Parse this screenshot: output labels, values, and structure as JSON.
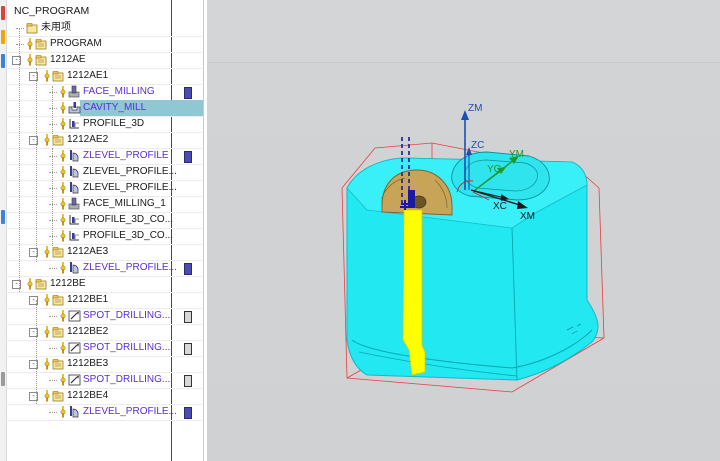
{
  "tree": {
    "root": "NC_PROGRAM",
    "rows": [
      {
        "label": "未用项",
        "kind": "group",
        "level": 1
      },
      {
        "label": "PROGRAM",
        "kind": "program",
        "level": 1
      },
      {
        "label": "1212AE",
        "kind": "program",
        "level": 1,
        "expand": "-"
      },
      {
        "label": "1212AE1",
        "kind": "program",
        "level": 2,
        "expand": "-"
      },
      {
        "label": "FACE_MILLING",
        "kind": "op",
        "icon": "face-milling-icon",
        "level": 3,
        "status": "regen"
      },
      {
        "label": "CAVITY_MILL",
        "kind": "op",
        "icon": "cavity-mill-icon",
        "level": 3,
        "selected": true
      },
      {
        "label": "PROFILE_3D",
        "kind": "op-dark",
        "icon": "profile-3d-icon",
        "level": 3
      },
      {
        "label": "1212AE2",
        "kind": "program",
        "level": 2,
        "expand": "-"
      },
      {
        "label": "ZLEVEL_PROFILE",
        "kind": "op",
        "icon": "zlevel-profile-icon",
        "level": 3,
        "status": "regen"
      },
      {
        "label": "ZLEVEL_PROFILE...",
        "kind": "op-dark",
        "icon": "zlevel-profile-icon",
        "level": 3
      },
      {
        "label": "ZLEVEL_PROFILE...",
        "kind": "op-dark",
        "icon": "zlevel-profile-icon",
        "level": 3
      },
      {
        "label": "FACE_MILLING_1",
        "kind": "op-dark",
        "icon": "face-milling-icon",
        "level": 3
      },
      {
        "label": "PROFILE_3D_CO...",
        "kind": "op-dark",
        "icon": "profile-3d-icon",
        "level": 3
      },
      {
        "label": "PROFILE_3D_CO...",
        "kind": "op-dark",
        "icon": "profile-3d-icon",
        "level": 3
      },
      {
        "label": "1212AE3",
        "kind": "program",
        "level": 2,
        "expand": "-"
      },
      {
        "label": "ZLEVEL_PROFILE...",
        "kind": "op",
        "icon": "zlevel-profile-icon",
        "level": 3,
        "status": "regen"
      },
      {
        "label": "1212BE",
        "kind": "program",
        "level": 1,
        "expand": "-"
      },
      {
        "label": "1212BE1",
        "kind": "program",
        "level": 2,
        "expand": "-"
      },
      {
        "label": "SPOT_DRILLING...",
        "kind": "op",
        "icon": "spot-drilling-icon",
        "level": 3,
        "status": "check"
      },
      {
        "label": "1212BE2",
        "kind": "program",
        "level": 2,
        "expand": "-"
      },
      {
        "label": "SPOT_DRILLING...",
        "kind": "op",
        "icon": "spot-drilling-icon",
        "level": 3,
        "status": "check"
      },
      {
        "label": "1212BE3",
        "kind": "program",
        "level": 2,
        "expand": "-"
      },
      {
        "label": "SPOT_DRILLING...",
        "kind": "op",
        "icon": "spot-drilling-icon",
        "level": 3,
        "status": "check"
      },
      {
        "label": "1212BE4",
        "kind": "program",
        "level": 2,
        "expand": "-"
      },
      {
        "label": "ZLEVEL_PROFILE...",
        "kind": "op",
        "icon": "zlevel-profile-icon",
        "level": 3,
        "status": "regen"
      }
    ]
  },
  "viewport": {
    "axes": {
      "zm": "ZM",
      "zc": "ZC",
      "yc": "YC",
      "ym": "YM",
      "xc": "XC",
      "xm": "XM"
    },
    "colors": {
      "part": "#22e8f2",
      "tool": "#ffff00",
      "fixture": "#c8a458",
      "bounding_box": "#e8262a",
      "axis_z": "#1a4fb8",
      "axis_y": "#1c9a2a",
      "axis_x": "#1a1a1a"
    }
  }
}
